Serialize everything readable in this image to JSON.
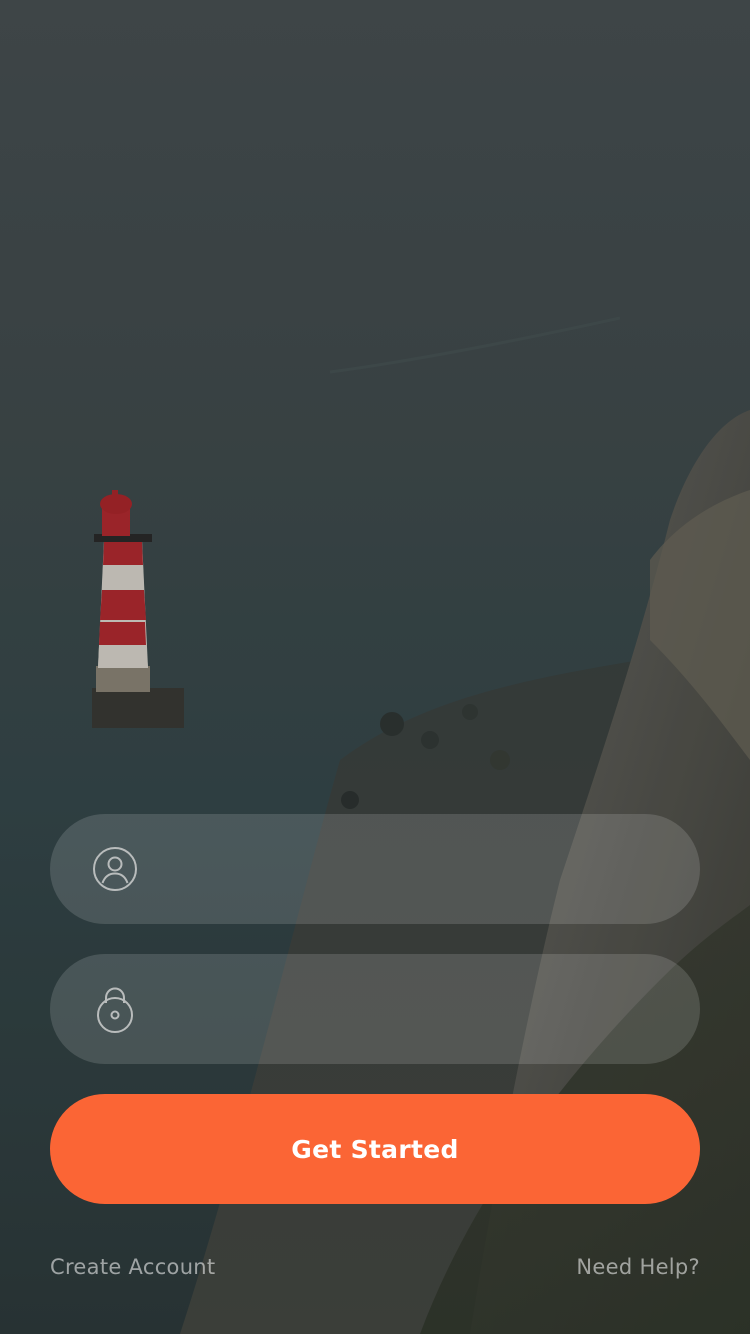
{
  "background": {
    "scene": "lighthouse-cliff-sea-photo"
  },
  "form": {
    "username": {
      "icon": "user-icon",
      "value": "",
      "placeholder": ""
    },
    "password": {
      "icon": "lock-icon",
      "value": "",
      "placeholder": ""
    },
    "submit_label": "Get Started"
  },
  "footer": {
    "create_account_label": "Create Account",
    "help_label": "Need Help?"
  },
  "colors": {
    "accent": "#fb6535",
    "overlay": "#3a4244"
  }
}
